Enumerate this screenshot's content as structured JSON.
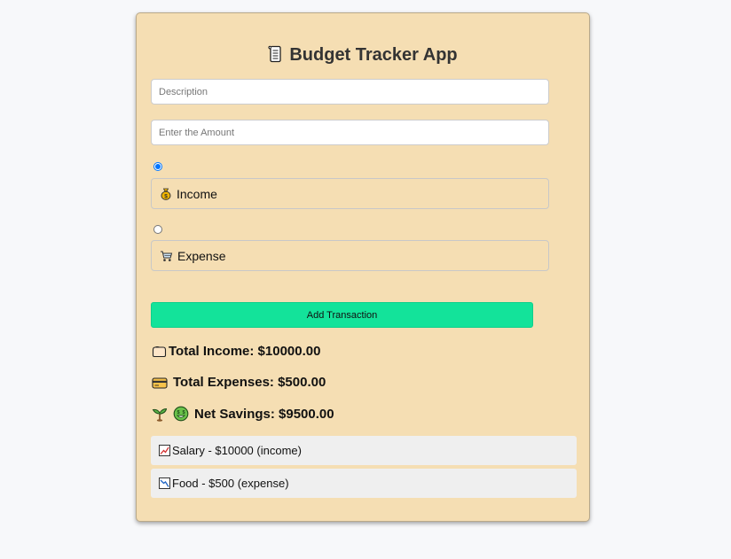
{
  "app": {
    "title": "Budget Tracker App",
    "title_icon": "scroll-icon"
  },
  "form": {
    "description_placeholder": "Description",
    "amount_placeholder": "Enter the Amount",
    "type_options": [
      {
        "label": "Income",
        "icon": "money-bag-icon",
        "selected": true
      },
      {
        "label": "Expense",
        "icon": "shopping-cart-icon",
        "selected": false
      }
    ],
    "add_button_label": "Add Transaction"
  },
  "summary": {
    "total_income": "Total Income: $10000.00",
    "total_expenses": "Total Expenses: $500.00",
    "net_savings": "Net Savings: $9500.00",
    "icons": [
      "wallet-icon",
      "credit-card-icon",
      "seedling-icon",
      "money-face-icon"
    ]
  },
  "transactions": [
    {
      "text": "Salary - $10000 (income)",
      "icon": "chart-up-icon"
    },
    {
      "text": "Food - $500 (expense)",
      "icon": "chart-down-icon"
    }
  ],
  "colors": {
    "card_background": "#f5deb3",
    "button": "#13e39a",
    "page_background": "#f7f8fa",
    "list_item": "#efefef"
  }
}
